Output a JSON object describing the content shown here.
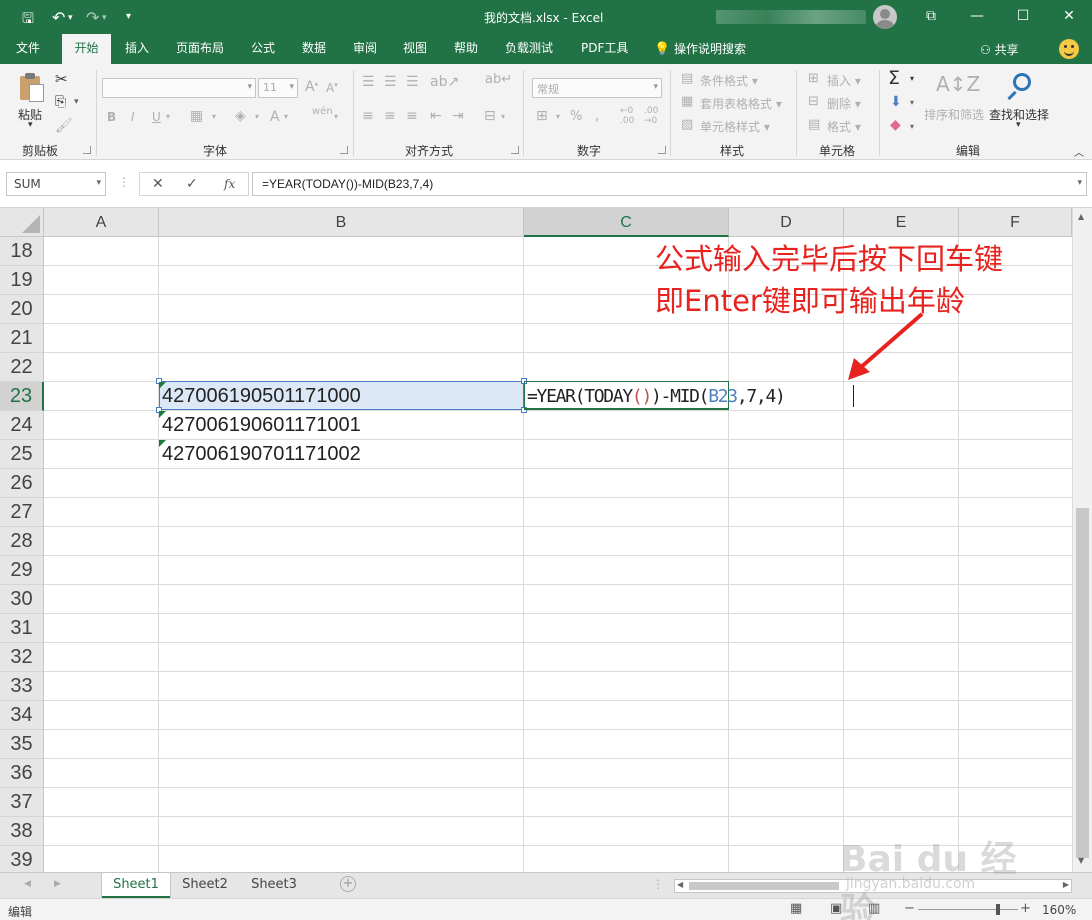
{
  "window": {
    "title": "我的文档.xlsx  -  Excel",
    "undo_glyph": "↶",
    "redo_glyph": "↷",
    "save_glyph": "🖫",
    "customize_glyph": "▾"
  },
  "tabs": [
    "文件",
    "开始",
    "插入",
    "页面布局",
    "公式",
    "数据",
    "审阅",
    "视图",
    "帮助",
    "负载测试",
    "PDF工具"
  ],
  "active_tab": "开始",
  "search_tab": "操作说明搜索",
  "share_label": "共享",
  "ribbon": {
    "paste_label": "粘贴",
    "groups": {
      "clipboard": "剪贴板",
      "font": "字体",
      "alignment": "对齐方式",
      "number": "数字",
      "styles": "样式",
      "cells": "单元格",
      "editing": "编辑"
    },
    "font_size": "11",
    "number_format": "常规",
    "conditional_format": "条件格式",
    "table_format": "套用表格格式",
    "cell_style": "单元格样式",
    "insert": "插入",
    "delete": "删除",
    "format": "格式",
    "sort_filter": "排序和筛选",
    "find_select": "查找和选择",
    "bold": "B",
    "italic": "I",
    "underline": "U",
    "wen": "wén",
    "percent": "%",
    "sigma": "Σ"
  },
  "formula_bar": {
    "name_box": "SUM",
    "cancel_glyph": "✕",
    "enter_glyph": "✓",
    "fx_label": "fx",
    "formula": "=YEAR(TODAY())-MID(B23,7,4)"
  },
  "grid": {
    "columns": [
      "A",
      "B",
      "C",
      "D",
      "E",
      "F"
    ],
    "rows": [
      "18",
      "19",
      "20",
      "21",
      "22",
      "23",
      "24",
      "25",
      "26",
      "27",
      "28",
      "29",
      "30",
      "31",
      "32",
      "33",
      "34",
      "35",
      "36",
      "37",
      "38",
      "39"
    ],
    "selected_column": "C",
    "selected_row": "23",
    "cells_b": {
      "b23": "427006190501171000",
      "b24": "427006190601171001",
      "b25": "427006190701171002"
    },
    "formula_parts": {
      "a": "=YEAR",
      "b": "(TODAY",
      "c": "()",
      "d": ")-MID(",
      "e": "B23",
      "f": ",7,4)"
    }
  },
  "annotation": {
    "line1": "公式输入完毕后按下回车键",
    "line2": "即Enter键即可输出年龄",
    "arrow_color": "#e8231f"
  },
  "sheets": [
    "Sheet1",
    "Sheet2",
    "Sheet3"
  ],
  "active_sheet": "Sheet1",
  "status": {
    "mode": "编辑",
    "zoom": "160%"
  },
  "watermark": {
    "logo": "Bai du 经验",
    "url": "jingyan.baidu.com"
  },
  "colors": {
    "excel_green": "#217346",
    "annotation_red": "#e8231f",
    "ref_blue": "#4f81bd",
    "paren_red": "#c0504d"
  }
}
